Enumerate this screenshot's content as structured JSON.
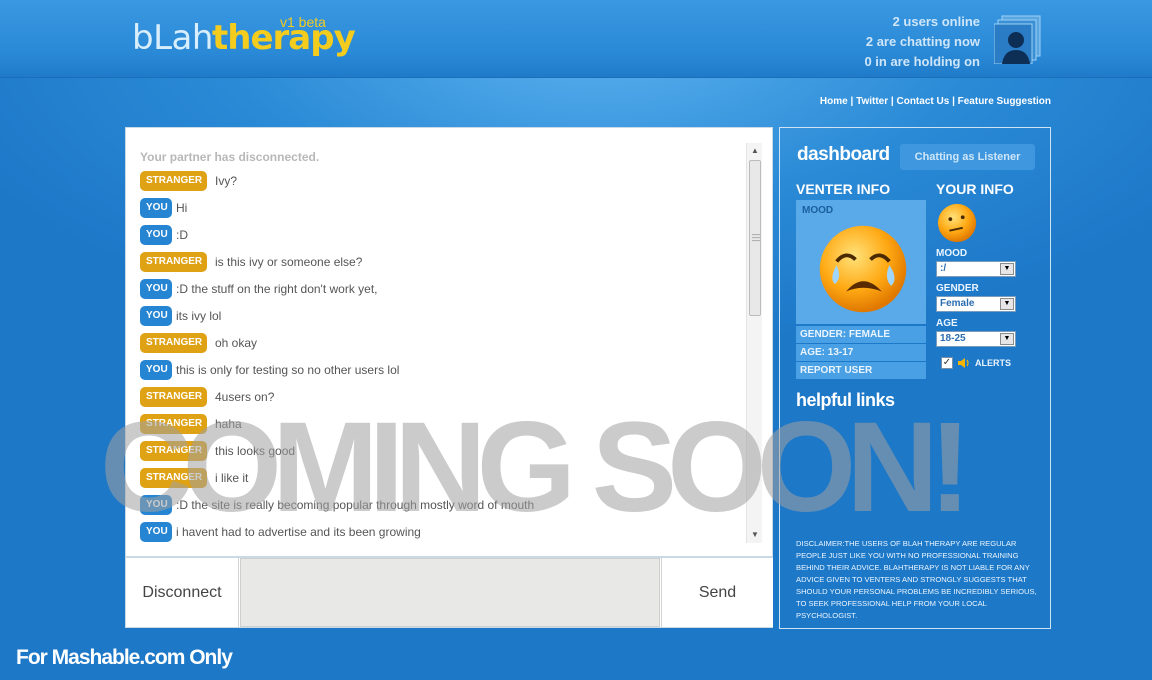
{
  "brand": {
    "name_part1": "bLah",
    "name_part2": "therapy",
    "version": "v1 beta"
  },
  "stats": {
    "online": "2 users online",
    "chatting": "2 are chatting now",
    "holding": "0 in are holding on"
  },
  "nav": {
    "home": "Home",
    "twitter": "Twitter",
    "contact": "Contact Us",
    "feature": "Feature Suggestion"
  },
  "chat": {
    "system_message": "Your partner has disconnected.",
    "messages": [
      {
        "sender": "STRANGER",
        "text": "Ivy?"
      },
      {
        "sender": "YOU",
        "text": "Hi"
      },
      {
        "sender": "YOU",
        "text": ":D"
      },
      {
        "sender": "STRANGER",
        "text": "is this ivy or someone else?"
      },
      {
        "sender": "YOU",
        "text": ":D the stuff on the right don't work yet,"
      },
      {
        "sender": "YOU",
        "text": "its ivy lol"
      },
      {
        "sender": "STRANGER",
        "text": "oh okay"
      },
      {
        "sender": "YOU",
        "text": "this is only for testing so no other users lol"
      },
      {
        "sender": "STRANGER",
        "text": "4users on?"
      },
      {
        "sender": "STRANGER",
        "text": "haha"
      },
      {
        "sender": "STRANGER",
        "text": "this looks good"
      },
      {
        "sender": "STRANGER",
        "text": "i like it"
      },
      {
        "sender": "YOU",
        "text": ":D the site is really becoming popular through mostly word of mouth"
      },
      {
        "sender": "YOU",
        "text": "i havent had to advertise and its been growing"
      }
    ],
    "input_value": ""
  },
  "controls": {
    "disconnect": "Disconnect",
    "send": "Send"
  },
  "dashboard": {
    "title": "dashboard",
    "mode": "Chatting as Listener",
    "venter_title": "VENTER INFO",
    "venter_mood_label": "MOOD",
    "venter_gender": "GENDER: FEMALE",
    "venter_age": "AGE: 13-17",
    "report": "REPORT USER",
    "your_title": "YOUR INFO",
    "mood_label": "MOOD",
    "mood_value": ":/",
    "gender_label": "GENDER",
    "gender_value": "Female",
    "age_label": "AGE",
    "age_value": "18-25",
    "alerts_label": "ALERTS",
    "alerts_checked": true,
    "helpful_title": "helpful links",
    "disclaimer": "DISCLAIMER:THE USERS OF BLAH THERAPY ARE REGULAR PEOPLE JUST LIKE YOU WITH NO PROFESSIONAL TRAINING BEHIND THEIR ADVICE. BLAHTHERAPY IS NOT LIABLE FOR ANY ADVICE GIVEN TO VENTERS AND STRONGLY SUGGESTS THAT SHOULD YOUR PERSONAL PROBLEMS BE INCREDIBLY SERIOUS, TO SEEK PROFESSIONAL HELP FROM YOUR LOCAL PSYCHOLOGIST."
  },
  "overlay": {
    "coming_soon": "COMING SOON!",
    "footer_note": "For Mashable.com Only"
  },
  "colors": {
    "stranger_badge": "#dfa214",
    "you_badge": "#2585d3",
    "background": "#2585d3",
    "logo_yellow": "#f4cc1e"
  },
  "icons": {
    "users": "users-icon",
    "venter_mood": "crying-face-icon",
    "your_mood": "confused-face-icon",
    "sound": "speaker-icon"
  }
}
